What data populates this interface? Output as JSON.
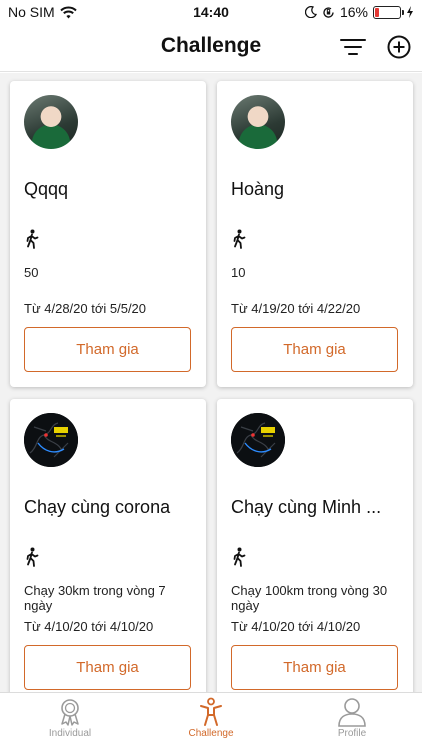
{
  "status_bar": {
    "carrier": "No SIM",
    "time": "14:40",
    "battery_text": "16%",
    "battery_level": 0.16
  },
  "header": {
    "title": "Challenge"
  },
  "challenges": [
    {
      "name": "Qqqq",
      "avatar": "person-photo",
      "target": "50",
      "dates": "Từ 4/28/20 tới 5/5/20",
      "join_label": "Tham gia"
    },
    {
      "name": "Hoàng",
      "avatar": "person-photo",
      "target": "10",
      "dates": "Từ 4/19/20 tới 4/22/20",
      "join_label": "Tham gia"
    },
    {
      "name": "Chạy cùng corona",
      "avatar": "route-map",
      "target": "Chạy 30km trong vòng 7 ngày",
      "dates": "Từ 4/10/20 tới 4/10/20",
      "join_label": "Tham gia"
    },
    {
      "name": "Chạy cùng Minh ...",
      "avatar": "route-map",
      "target": "Chạy 100km trong vòng 30 ngày",
      "dates": "Từ 4/10/20 tới 4/10/20",
      "join_label": "Tham gia"
    }
  ],
  "tabs": [
    {
      "label": "Individual",
      "icon": "medal-icon",
      "active": false
    },
    {
      "label": "Challenge",
      "icon": "person-activity-icon",
      "active": true
    },
    {
      "label": "Profile",
      "icon": "user-icon",
      "active": false
    }
  ],
  "colors": {
    "accent": "#d2692a",
    "background": "#f2f2f2",
    "card": "#ffffff",
    "inactive_tab": "#9a9a9a",
    "battery_low": "#e53935"
  }
}
